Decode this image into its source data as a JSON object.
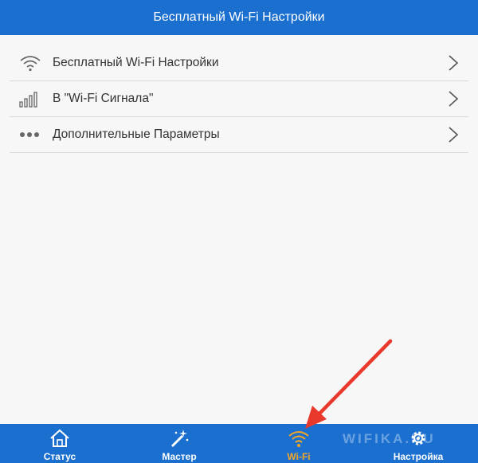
{
  "header": {
    "title": "Бесплатный Wi-Fi Настройки"
  },
  "list": {
    "items": [
      {
        "label": "Бесплатный Wi-Fi Настройки",
        "icon": "wifi-icon"
      },
      {
        "label": "В \"Wi-Fi Сигнала\"",
        "icon": "signal-bars-icon"
      },
      {
        "label": "Дополнительные Параметры",
        "icon": "more-dots-icon"
      }
    ]
  },
  "tabbar": {
    "tabs": [
      {
        "label": "Статус",
        "icon": "home-icon"
      },
      {
        "label": "Мастер",
        "icon": "magic-wand-icon"
      },
      {
        "label": "Wi-Fi",
        "icon": "wifi-icon",
        "active": true
      },
      {
        "label": "Настройка",
        "icon": "gear-icon"
      }
    ]
  },
  "watermark": "WIFIKA.RU",
  "colors": {
    "header_bg": "#1b6fcf",
    "active_tab": "#f5a623",
    "annotation_arrow": "#e8392c"
  }
}
